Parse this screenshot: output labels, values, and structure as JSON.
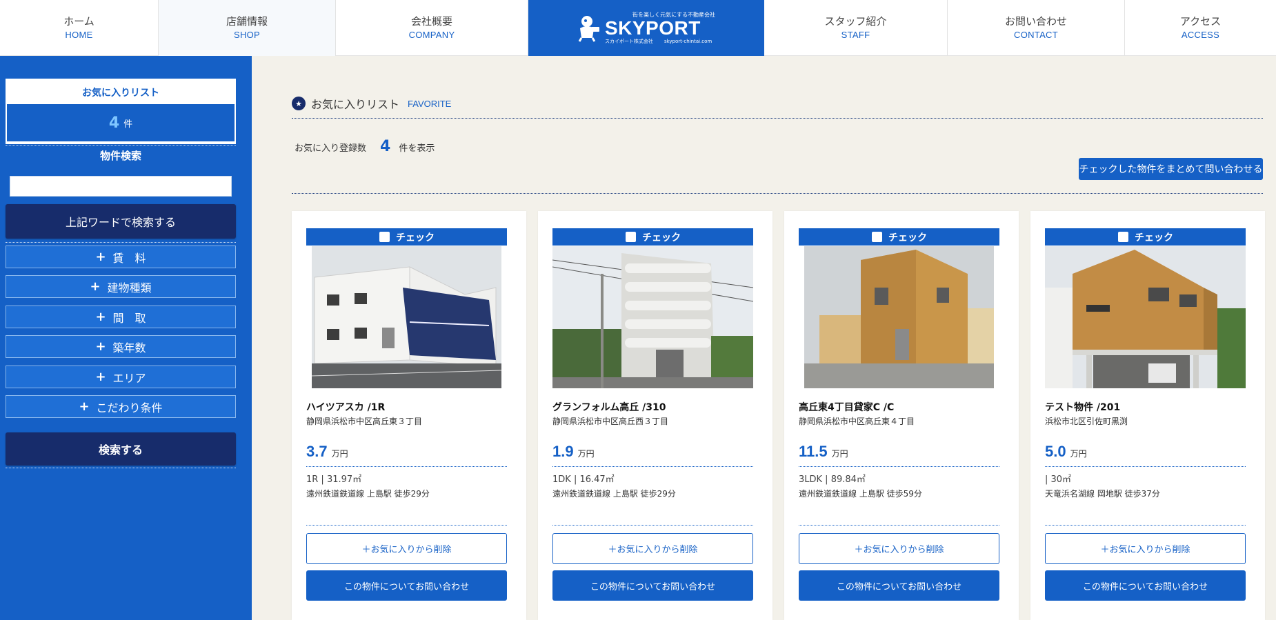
{
  "nav": {
    "items": [
      {
        "jp": "ホーム",
        "en": "HOME"
      },
      {
        "jp": "店舗情報",
        "en": "SHOP"
      },
      {
        "jp": "会社概要",
        "en": "COMPANY"
      },
      {
        "jp": "スタッフ紹介",
        "en": "STAFF"
      },
      {
        "jp": "お問い合わせ",
        "en": "CONTACT"
      },
      {
        "jp": "アクセス",
        "en": "ACCESS"
      }
    ],
    "logo": {
      "tagline": "街を楽しく元気にする不動産会社",
      "name": "SKYPORT",
      "company": "スカイポート株式会社",
      "url": "skyport-chintai.com"
    }
  },
  "sidebar": {
    "favorites_title": "お気に入りリスト",
    "favorites_count": "4",
    "favorites_unit": "件",
    "search_title": "物件検索",
    "search_value": "",
    "word_search_label": "上記ワードで検索する",
    "filters": [
      "賃　料",
      "建物種類",
      "間　取",
      "築年数",
      "エリア",
      "こだわり条件"
    ],
    "search_label": "検索する"
  },
  "main": {
    "title": "お気に入りリスト",
    "title_en": "FAVORITE",
    "count_label": "お気に入り登録数",
    "count": "4",
    "count_suffix": "件を表示",
    "bulk_inquiry_label": "チェックした物件をまとめて問い合わせる"
  },
  "properties": [
    {
      "check_label": "チェック",
      "name": "ハイツアスカ /1R",
      "address": "静岡県浜松市中区高丘東３丁目",
      "price": "3.7",
      "price_unit": "万円",
      "spec": "1R | 31.97㎡",
      "access": "遠州鉄道鉄道線 上島駅 徒歩29分",
      "remove_label": "＋お気に入りから削除",
      "inquire_label": "この物件についてお問い合わせ"
    },
    {
      "check_label": "チェック",
      "name": "グランフォルム高丘 /310",
      "address": "静岡県浜松市中区高丘西３丁目",
      "price": "1.9",
      "price_unit": "万円",
      "spec": "1DK | 16.47㎡",
      "access": "遠州鉄道鉄道線 上島駅 徒歩29分",
      "remove_label": "＋お気に入りから削除",
      "inquire_label": "この物件についてお問い合わせ"
    },
    {
      "check_label": "チェック",
      "name": "高丘東4丁目貸家C /C",
      "address": "静岡県浜松市中区高丘東４丁目",
      "price": "11.5",
      "price_unit": "万円",
      "spec": "3LDK | 89.84㎡",
      "access": "遠州鉄道鉄道線 上島駅 徒歩59分",
      "remove_label": "＋お気に入りから削除",
      "inquire_label": "この物件についてお問い合わせ"
    },
    {
      "check_label": "チェック",
      "name": "テスト物件 /201",
      "address": "浜松市北区引佐町黒渕",
      "price": "5.0",
      "price_unit": "万円",
      "spec": " | 30㎡",
      "access": "天竜浜名湖線 岡地駅 徒歩37分",
      "remove_label": "＋お気に入りから削除",
      "inquire_label": "この物件についてお問い合わせ"
    }
  ],
  "colors": {
    "brand_blue": "#1560c6",
    "navy": "#172c6b",
    "background": "#f3f1ea"
  }
}
